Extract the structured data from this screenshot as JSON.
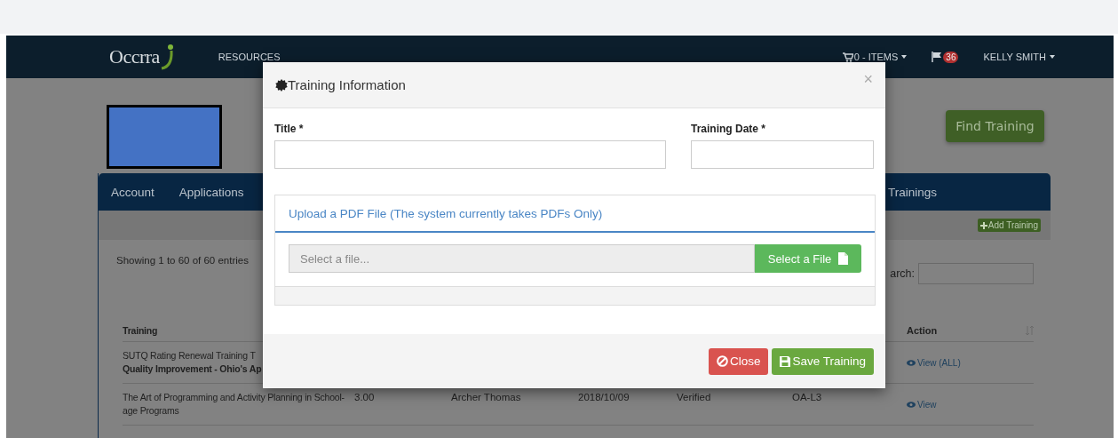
{
  "navbar": {
    "logo": "Occrra",
    "links": [
      "RESOURCES"
    ],
    "cart": "0 - ITEMS",
    "notifications": "36",
    "user": "KELLY SMITH"
  },
  "find_button": "Find Training",
  "tabs": [
    {
      "label": "Account"
    },
    {
      "label": "Applications"
    },
    {
      "label": "Trainings"
    }
  ],
  "add_button": "Add Training",
  "entries_info": "Showing 1 to 60 of 60 entries",
  "search_label": "arch:",
  "table": {
    "columns": [
      "Training",
      "Action"
    ],
    "rows": [
      {
        "training": "SUTQ Rating Renewal Training T",
        "subtitle": "Quality Improvement - Ohio's Ap",
        "action": "View (ALL)"
      },
      {
        "training": "The Art of Programming and Activity Planning in School-age Programs",
        "column_2": "3.00",
        "column_3": "Archer Thomas",
        "column_4": "2018/10/09",
        "column_5": "Verified",
        "column_6": "OA-L3",
        "action": "View"
      }
    ]
  },
  "modal": {
    "title": "Training Information",
    "close": "×",
    "fields": [
      {
        "label": "Title *"
      },
      {
        "label": "Training Date *"
      }
    ],
    "upload": {
      "heading": "Upload a PDF File (The system currently takes PDFs Only)",
      "placeholder": "Select a file...",
      "button": "Select a File"
    },
    "buttons": [
      {
        "label": "Close",
        "kind": "danger"
      },
      {
        "label": "Save Training",
        "kind": "success"
      }
    ]
  }
}
